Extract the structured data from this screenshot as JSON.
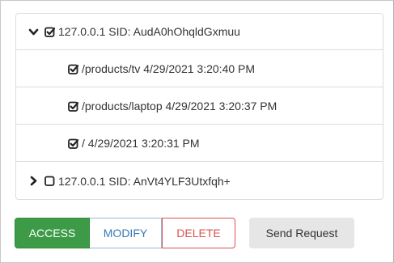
{
  "tree": {
    "sessions": [
      {
        "label": "127.0.0.1 SID: AudA0hOhqldGxmuu",
        "expanded": true,
        "checked": true,
        "icon": "chevron-down-icon",
        "children": [
          {
            "label": "/products/tv 4/29/2021 3:20:40 PM",
            "checked": true
          },
          {
            "label": "/products/laptop 4/29/2021 3:20:37 PM",
            "checked": true
          },
          {
            "label": "/ 4/29/2021 3:20:31 PM",
            "checked": true
          }
        ]
      },
      {
        "label": "127.0.0.1 SID: AnVt4YLF3Utxfqh+",
        "expanded": false,
        "checked": false,
        "icon": "chevron-right-icon",
        "children": []
      }
    ]
  },
  "actions": {
    "access_label": "ACCESS",
    "modify_label": "MODIFY",
    "delete_label": "DELETE",
    "send_label": "Send Request",
    "selected": "ACCESS"
  },
  "colors": {
    "access_bg": "#3d9b48",
    "modify_text": "#337ab7",
    "delete_text": "#d9534f",
    "send_bg": "#e6e6e6"
  }
}
